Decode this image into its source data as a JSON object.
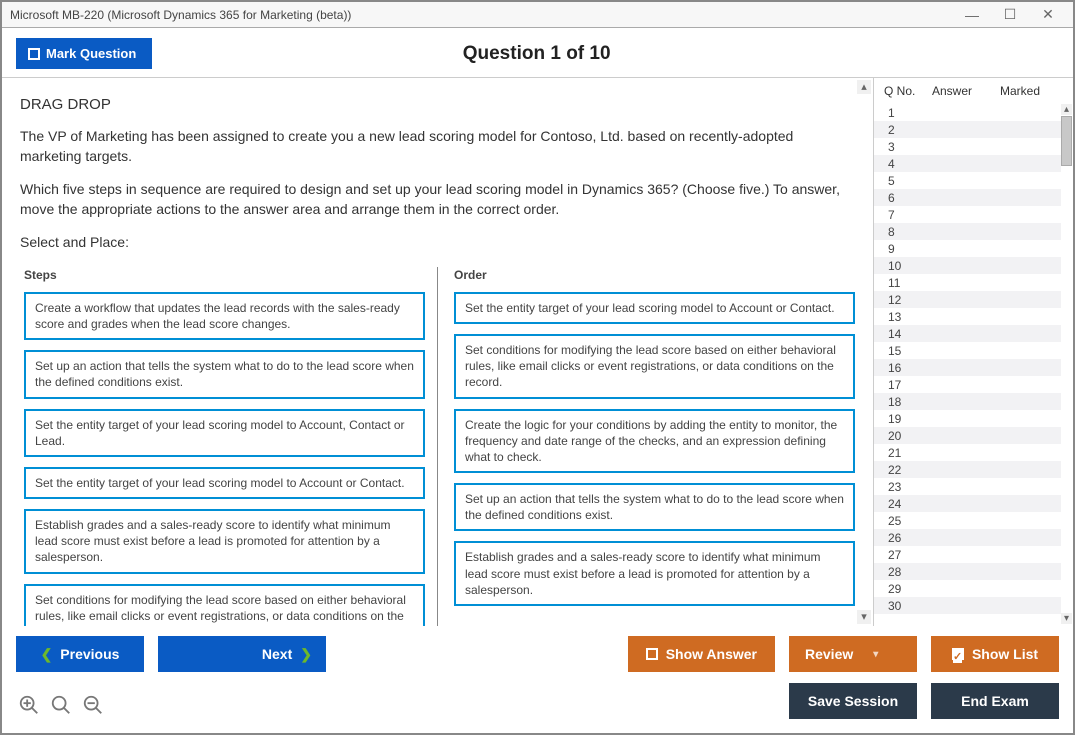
{
  "window": {
    "title": "Microsoft MB-220 (Microsoft Dynamics 365 for Marketing (beta))"
  },
  "topbar": {
    "mark_label": "Mark Question",
    "counter": "Question 1 of 10"
  },
  "question": {
    "type_label": "DRAG DROP",
    "para1": "The VP of Marketing has been assigned to create you a new lead scoring model for Contoso, Ltd. based on recently-adopted marketing targets.",
    "para2": "Which five steps in sequence are required to design and set up your lead scoring model in Dynamics 365? (Choose five.) To answer, move the appropriate actions to the answer area and arrange them in the correct order.",
    "select_label": "Select and Place:",
    "steps_header": "Steps",
    "order_header": "Order",
    "steps": [
      "Create a workflow that updates the lead records with the sales-ready score and grades when the lead score changes.",
      "Set up an action that tells the system what to do to the lead score when the defined conditions exist.",
      "Set the entity target of your lead scoring model to Account, Contact or Lead.",
      "Set the entity target of your lead scoring model to Account or Contact.",
      "Establish grades and a sales-ready score to identify what minimum lead score must exist before a lead is promoted for attention by a salesperson.",
      "Set conditions for modifying the lead score based on either behavioral rules, like email clicks or event registrations, or data conditions on the record."
    ],
    "order": [
      "Set the entity target of your lead scoring model to Account or Contact.",
      "Set conditions for modifying the lead score based on either behavioral rules, like email clicks or event registrations, or data conditions on the record.",
      "Create the logic for your conditions by adding the entity to monitor, the frequency and date range of the checks, and an expression defining what to check.",
      "Set up an action that tells the system what to do to the lead score when the defined conditions exist.",
      "Establish grades and a sales-ready score to identify what minimum lead score must exist before a lead is promoted for attention by a salesperson."
    ]
  },
  "sidebar": {
    "col_qno": "Q No.",
    "col_answer": "Answer",
    "col_marked": "Marked",
    "rows": [
      "1",
      "2",
      "3",
      "4",
      "5",
      "6",
      "7",
      "8",
      "9",
      "10",
      "11",
      "12",
      "13",
      "14",
      "15",
      "16",
      "17",
      "18",
      "19",
      "20",
      "21",
      "22",
      "23",
      "24",
      "25",
      "26",
      "27",
      "28",
      "29",
      "30"
    ]
  },
  "footer": {
    "previous": "Previous",
    "next": "Next",
    "show_answer": "Show Answer",
    "review": "Review",
    "show_list": "Show List",
    "save_session": "Save Session",
    "end_exam": "End Exam"
  }
}
